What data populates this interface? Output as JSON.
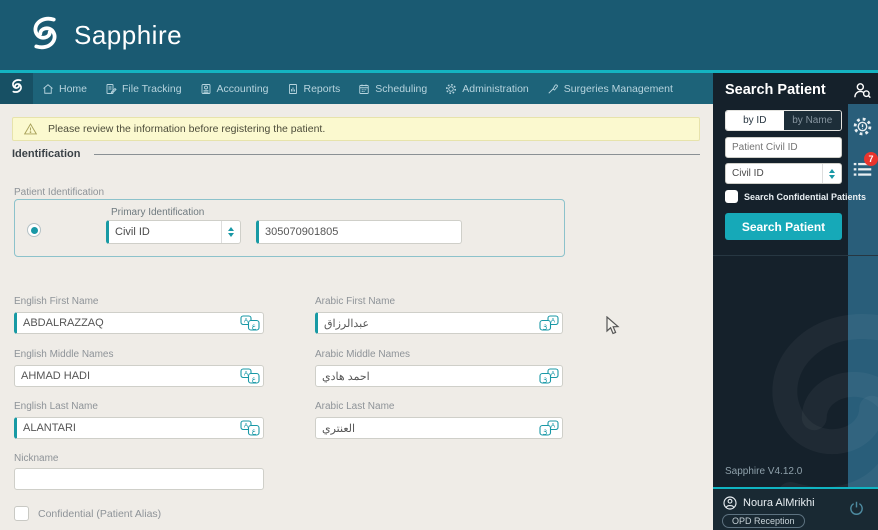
{
  "header": {
    "app_name": "Sapphire"
  },
  "nav": {
    "items": [
      {
        "label": "Home"
      },
      {
        "label": "File Tracking"
      },
      {
        "label": "Accounting"
      },
      {
        "label": "Reports"
      },
      {
        "label": "Scheduling"
      },
      {
        "label": "Administration"
      },
      {
        "label": "Surgeries Management"
      }
    ]
  },
  "main": {
    "warning": "Please review the information before registering the patient.",
    "section_title": "Identification",
    "patient_identification_label": "Patient Identification",
    "primary_identification": {
      "legend": "Primary Identification",
      "type_value": "Civil ID",
      "id_value": "305070901805"
    },
    "fields": {
      "english_first": {
        "label": "English First Name",
        "value": "ABDALRAZZAQ"
      },
      "arabic_first": {
        "label": "Arabic First Name",
        "value": "عبدالرزاق"
      },
      "english_middle": {
        "label": "English Middle Names",
        "value": "AHMAD HADI"
      },
      "arabic_middle": {
        "label": "Arabic Middle Names",
        "value": "احمد هادي"
      },
      "english_last": {
        "label": "English Last Name",
        "value": "ALANTARI"
      },
      "arabic_last": {
        "label": "Arabic Last Name",
        "value": "العنتري"
      },
      "nickname": {
        "label": "Nickname",
        "value": ""
      }
    },
    "confidential_checkbox_label": "Confidential (Patient Alias)"
  },
  "sidebar": {
    "title": "Search Patient",
    "tabs": {
      "by_id": "by ID",
      "by_name": "by Name"
    },
    "civil_id_placeholder": "Patient Civil ID",
    "id_type_value": "Civil ID",
    "confidential_label": "Search Confidential Patients",
    "search_button": "Search Patient",
    "notification_count": "7",
    "version": "Sapphire V4.12.0"
  },
  "user": {
    "name": "Noura AlMrikhi",
    "role": "OPD Reception"
  },
  "colors": {
    "header_teal": "#1a5a72",
    "nav_teal": "#1d6379",
    "accent_teal": "#14b3c1",
    "button_teal": "#16a9b8",
    "field_accent_teal": "#189aa4",
    "badge_red": "#e8352e",
    "banner_yellow": "#fbf9cf",
    "sidebar_dark": "#15212b",
    "strip_blue": "#295e7a"
  }
}
